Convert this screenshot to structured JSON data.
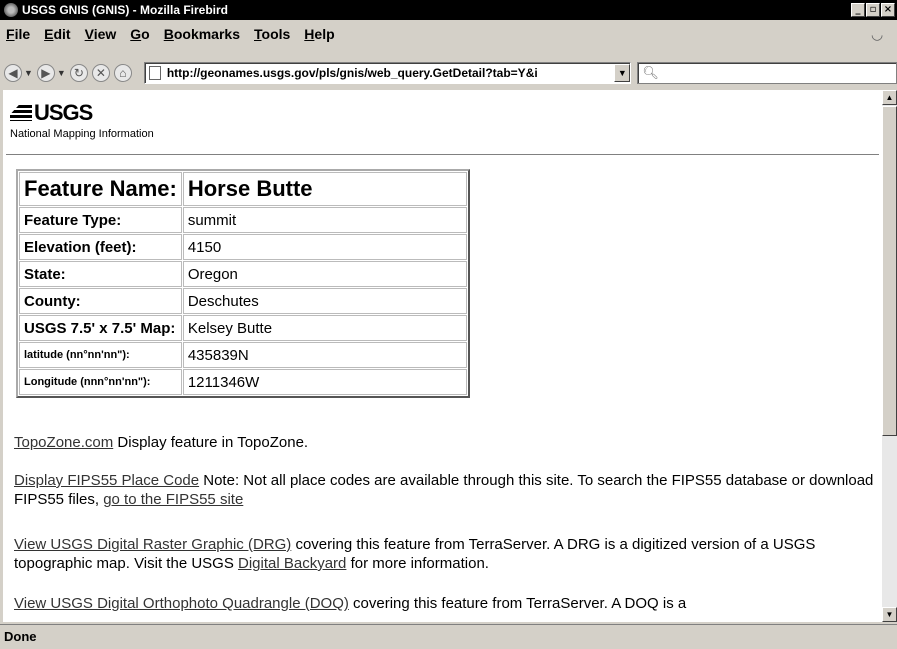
{
  "window": {
    "title": "USGS GNIS (GNIS) - Mozilla Firebird",
    "buttons": [
      "_",
      "̅❒",
      "×"
    ]
  },
  "menu": [
    {
      "label": "File",
      "key": "F"
    },
    {
      "label": "Edit",
      "key": "E"
    },
    {
      "label": "View",
      "key": "V"
    },
    {
      "label": "Go",
      "key": "G"
    },
    {
      "label": "Bookmarks",
      "key": "B"
    },
    {
      "label": "Tools",
      "key": "T"
    },
    {
      "label": "Help",
      "key": "H"
    }
  ],
  "nav": {
    "url": "http://geonames.usgs.gov/pls/gnis/web_query.GetDetail?tab=Y&i",
    "search_placeholder": ""
  },
  "header": {
    "logo_text": "USGS",
    "subtitle": "National Mapping Information"
  },
  "feature": {
    "name_label": "Feature Name:",
    "name_value": "Horse Butte",
    "rows": [
      {
        "label": "Feature Type:",
        "value": "summit",
        "small": false
      },
      {
        "label": "Elevation (feet):",
        "value": "4150",
        "small": false
      },
      {
        "label": "State:",
        "value": "Oregon",
        "small": false
      },
      {
        "label": "County:",
        "value": "Deschutes",
        "small": false
      },
      {
        "label": "USGS 7.5' x 7.5' Map:",
        "value": "Kelsey Butte",
        "small": false
      },
      {
        "label": "latitude (nn°nn'nn\"):",
        "value": "435839N",
        "small": true
      },
      {
        "label": "Longitude (nnn°nn'nn\"):",
        "value": "1211346W",
        "small": true
      }
    ]
  },
  "paragraphs": {
    "topozone_link": "TopoZone.com",
    "topozone_text": " Display feature in TopoZone.",
    "fips_link": "Display FIPS55 Place Code",
    "fips_text": " Note: Not all place codes are available through this site. To search the FIPS55 database or download FIPS55 files, ",
    "fips_link2": "go to the FIPS55 site",
    "drg_link": "View USGS Digital Raster Graphic (DRG)",
    "drg_text": " covering this feature from TerraServer. A DRG is a digitized version of a USGS topographic map. Visit the USGS ",
    "drg_link2": "Digital Backyard",
    "drg_text2": " for more information.",
    "doq_link": "View USGS Digital Orthophoto Quadrangle (DOQ)",
    "doq_text": " covering this feature from TerraServer. A DOQ is a"
  },
  "status": {
    "text": "Done"
  }
}
